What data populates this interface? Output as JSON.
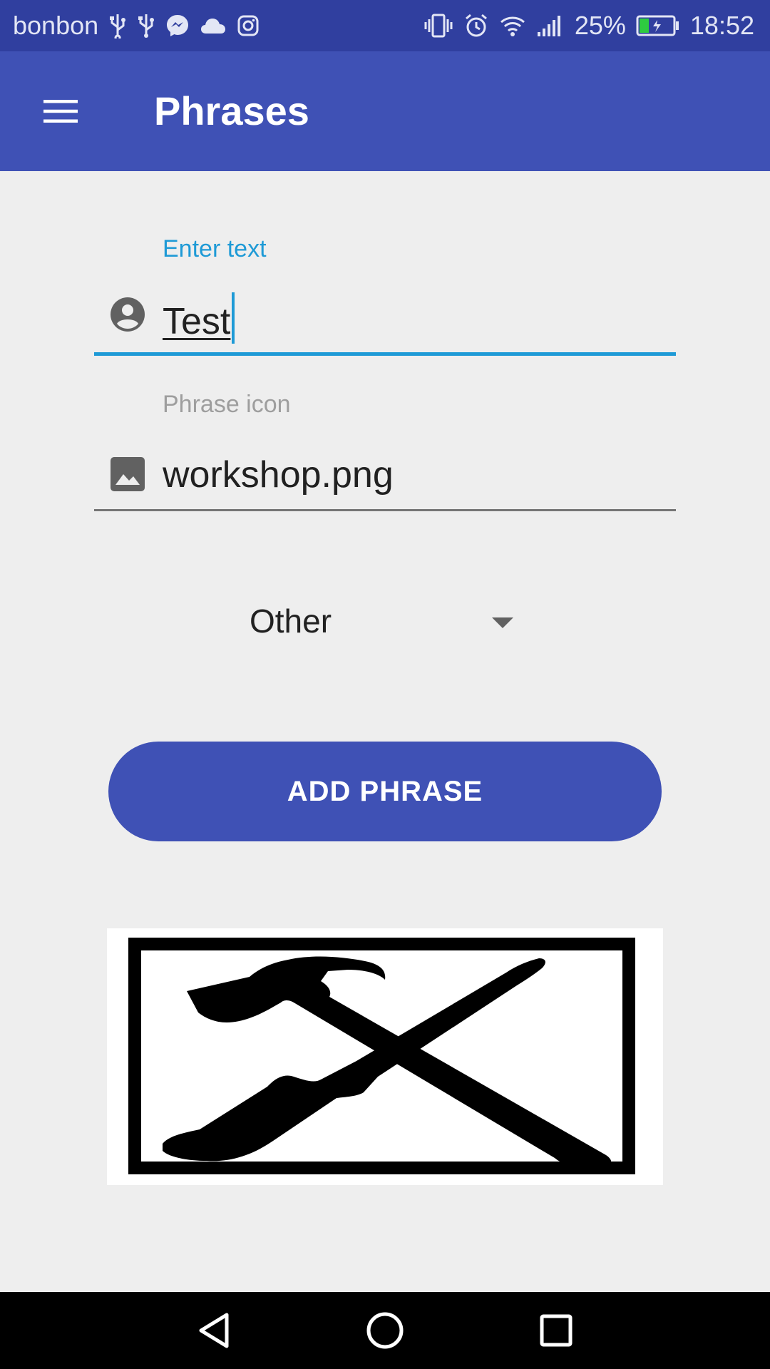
{
  "status_bar": {
    "carrier": "bonbon",
    "battery_percent": "25%",
    "time": "18:52",
    "left_icons": [
      "usb-icon",
      "usb-icon",
      "messenger-icon",
      "cloud-icon",
      "instagram-icon"
    ],
    "right_icons": [
      "vibrate-icon",
      "alarm-icon",
      "wifi-icon",
      "signal-icon",
      "battery-icon"
    ]
  },
  "app_bar": {
    "title": "Phrases",
    "menu_icon": "hamburger-menu-icon",
    "background": "#3F51B5"
  },
  "form": {
    "text_field": {
      "label": "Enter text",
      "value": "Test",
      "icon": "account-circle-icon",
      "accent": "#1E9AD6"
    },
    "icon_field": {
      "label": "Phrase icon",
      "value": "workshop.png",
      "icon": "image-icon"
    },
    "category_select": {
      "selected": "Other"
    },
    "submit_label": "ADD PHRASE"
  },
  "preview": {
    "image": "workshop-tools-icon"
  },
  "nav_bar": {
    "buttons": [
      "back-icon",
      "home-icon",
      "recents-icon"
    ]
  }
}
